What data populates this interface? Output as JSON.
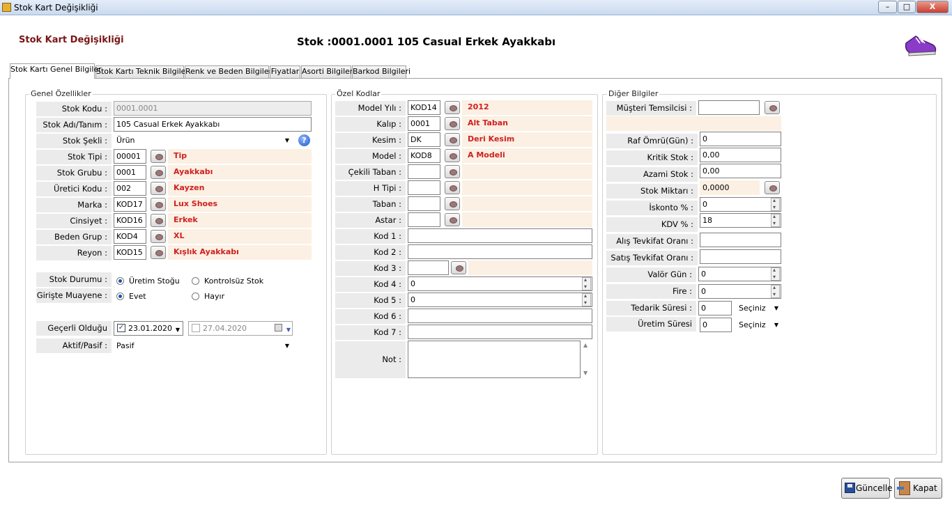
{
  "window": {
    "title": "Stok Kart Değişikliği",
    "min": "–",
    "max": "□",
    "close": "X"
  },
  "header": {
    "left_title": "Stok Kart Değişikliği",
    "main_title": "Stok :0001.0001 105 Casual Erkek Ayakkabı"
  },
  "tabs": [
    "Stok Kartı Genel Bilgiler",
    "Stok Kartı Teknik Bilgileri",
    "Renk ve Beden Bilgileri",
    "Fiyatlar",
    "Asorti Bilgileri",
    "Barkod Bilgileri"
  ],
  "genel": {
    "legend": "Genel Özellikler",
    "stok_kodu_label": "Stok Kodu :",
    "stok_kodu": "0001.0001",
    "stok_adi_label": "Stok Adı/Tanım :",
    "stok_adi": "105 Casual Erkek Ayakkabı",
    "stok_sekli_label": "Stok Şekli :",
    "stok_sekli": "Ürün",
    "rows": [
      {
        "label": "Stok Tipi :",
        "code": "00001",
        "desc": "Tip"
      },
      {
        "label": "Stok Grubu :",
        "code": "0001",
        "desc": "Ayakkabı"
      },
      {
        "label": "Üretici Kodu :",
        "code": "002",
        "desc": "Kayzen"
      },
      {
        "label": "Marka :",
        "code": "KOD17",
        "desc": "Lux Shoes"
      },
      {
        "label": "Cinsiyet :",
        "code": "KOD16",
        "desc": "Erkek"
      },
      {
        "label": "Beden Grup :",
        "code": "KOD4",
        "desc": "XL"
      },
      {
        "label": "Reyon :",
        "code": "KOD15",
        "desc": "Kışlık Ayakkabı"
      }
    ],
    "stok_durumu_label": "Stok Durumu :",
    "uretim_stogu": "Üretim Stoğu",
    "kontrolsuz_stok": "Kontrolsüz Stok",
    "giriste_label": "Girişte Muayene :",
    "evet": "Evet",
    "hayir": "Hayır",
    "gecerli_label": "Geçerli Olduğu",
    "date_from": "23.01.2020",
    "date_to": "27.04.2020",
    "aktif_label": "Aktif/Pasif :",
    "aktif_value": "Pasif"
  },
  "ozel": {
    "legend": "Özel Kodlar",
    "rows": [
      {
        "label": "Model Yılı :",
        "code": "KOD14",
        "desc": "2012"
      },
      {
        "label": "Kalıp :",
        "code": "0001",
        "desc": "Alt Taban"
      },
      {
        "label": "Kesim :",
        "code": "DK",
        "desc": "Deri Kesim"
      },
      {
        "label": "Model :",
        "code": "KOD8",
        "desc": "A Modeli"
      },
      {
        "label": "Çekili Taban :",
        "code": "",
        "desc": ""
      },
      {
        "label": "H Tipi :",
        "code": "",
        "desc": ""
      },
      {
        "label": "Taban :",
        "code": "",
        "desc": ""
      },
      {
        "label": "Astar :",
        "code": "",
        "desc": ""
      }
    ],
    "kod1_label": "Kod 1 :",
    "kod2_label": "Kod 2 :",
    "kod3_label": "Kod 3 :",
    "kod4_label": "Kod 4 :",
    "kod4": "0",
    "kod5_label": "Kod 5 :",
    "kod5": "0",
    "kod6_label": "Kod 6 :",
    "kod7_label": "Kod 7 :",
    "not_label": "Not :"
  },
  "diger": {
    "legend": "Diğer Bilgiler",
    "musteri_label": "Müşteri Temsilcisi :",
    "raf_label": "Raf Ömrü(Gün) :",
    "raf": "0",
    "kritik_label": "Kritik Stok :",
    "kritik": "0,00",
    "azami_label": "Azami Stok :",
    "azami": "0,00",
    "miktar_label": "Stok Miktarı :",
    "miktar": "0,0000",
    "iskonto_label": "İskonto % :",
    "iskonto": "0",
    "kdv_label": "KDV % :",
    "kdv": "18",
    "alis_label": "Alış Tevkifat Oranı :",
    "satis_label": "Satış Tevkifat Oranı :",
    "valor_label": "Valör Gün :",
    "valor": "0",
    "fire_label": "Fire :",
    "fire": "0",
    "tedarik_label": "Tedarik Süresi :",
    "tedarik": "0",
    "tedarik_unit": "Seçiniz",
    "uretim_label": "Üretim Süresi",
    "uretim": "0",
    "uretim_unit": "Seçiniz"
  },
  "footer": {
    "guncelle": "Güncelle",
    "kapat": "Kapat"
  },
  "colors": {
    "desc_red": "#d02020",
    "header_red": "#7a1414",
    "pink": "#fbf0e3"
  }
}
